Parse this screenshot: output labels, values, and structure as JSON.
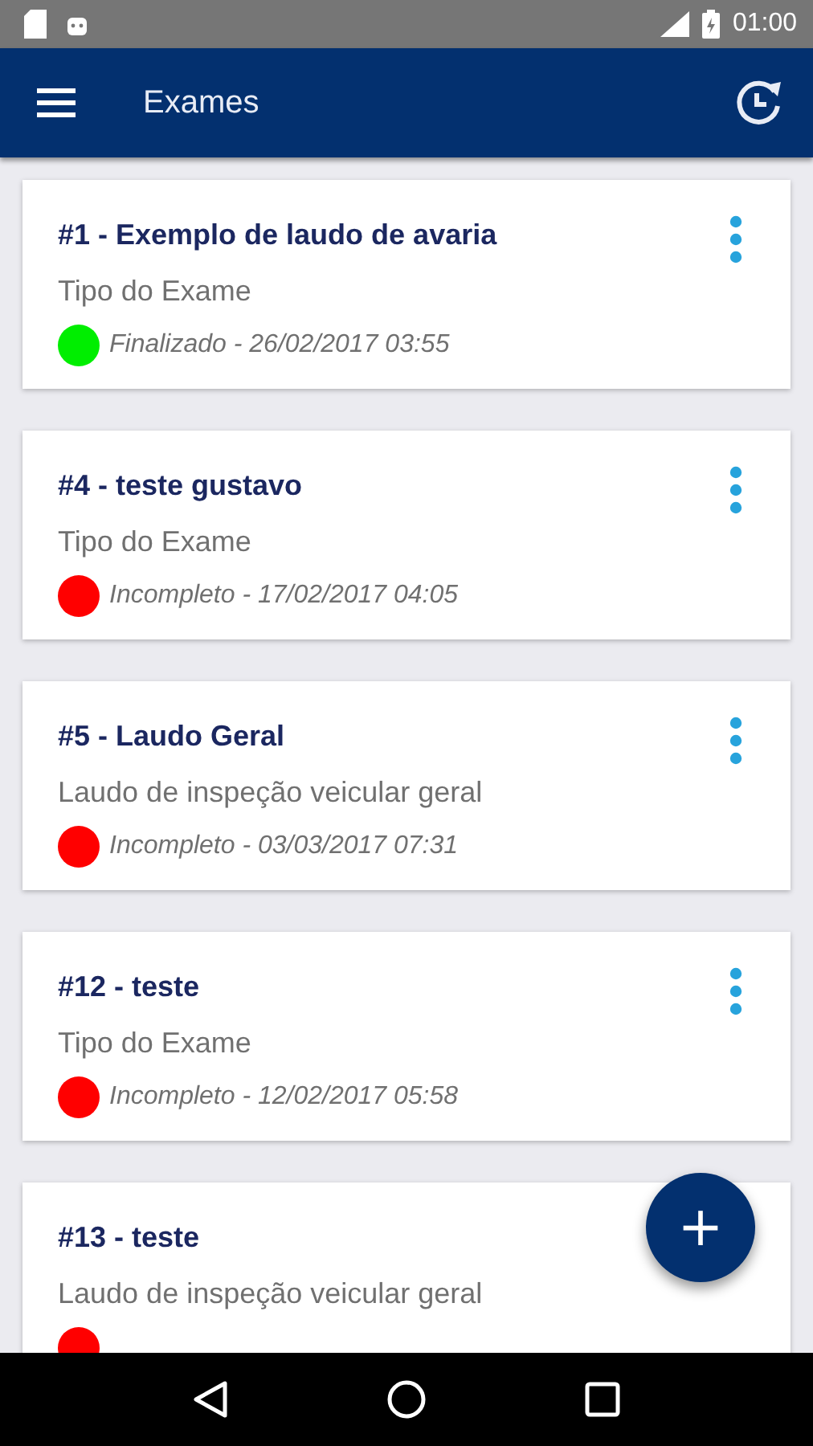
{
  "status_bar": {
    "time": "01:00"
  },
  "toolbar": {
    "title": "Exames"
  },
  "exams": [
    {
      "title": "#1 - Exemplo de laudo de avaria",
      "type": "Tipo do Exame",
      "status": "Finalizado - 26/02/2017 03:55",
      "color": "#00ee00"
    },
    {
      "title": "#4 - teste gustavo",
      "type": "Tipo do Exame",
      "status": "Incompleto - 17/02/2017 04:05",
      "color": "#ff0000"
    },
    {
      "title": "#5 - Laudo Geral",
      "type": "Laudo de inspeção veicular geral",
      "status": "Incompleto - 03/03/2017 07:31",
      "color": "#ff0000"
    },
    {
      "title": "#12 - teste",
      "type": "Tipo do Exame",
      "status": "Incompleto - 12/02/2017 05:58",
      "color": "#ff0000"
    },
    {
      "title": "#13 - teste",
      "type": "Laudo de inspeção veicular geral",
      "color": "#ff0000"
    }
  ],
  "fab": {
    "label": "+"
  }
}
